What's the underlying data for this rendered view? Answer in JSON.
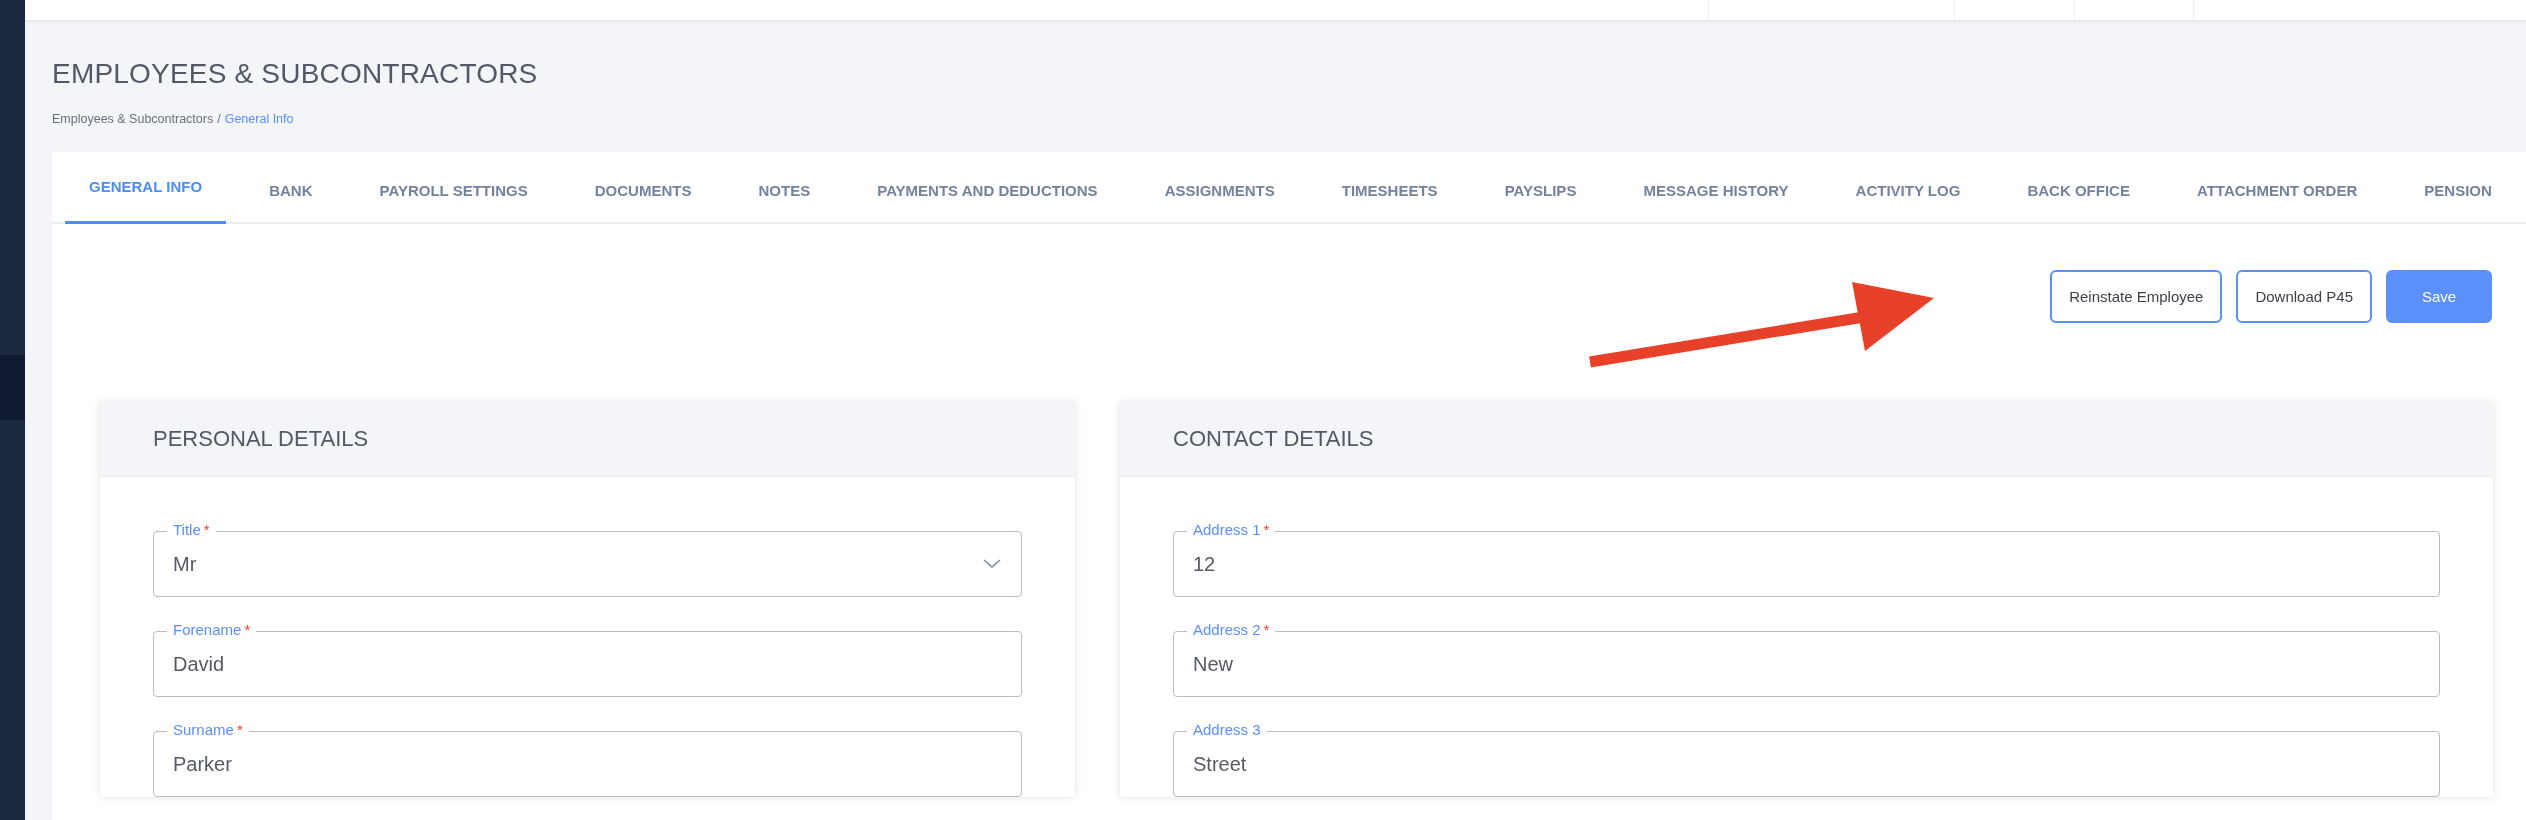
{
  "page_title": "EMPLOYEES & SUBCONTRACTORS",
  "breadcrumb": {
    "items": [
      {
        "label": "Employees & Subcontractors",
        "current": false
      },
      {
        "label": "General Info",
        "current": true
      }
    ],
    "separator": "/"
  },
  "tabs": [
    {
      "label": "GENERAL INFO",
      "selected": true
    },
    {
      "label": "BANK",
      "selected": false
    },
    {
      "label": "PAYROLL SETTINGS",
      "selected": false
    },
    {
      "label": "DOCUMENTS",
      "selected": false
    },
    {
      "label": "NOTES",
      "selected": false
    },
    {
      "label": "PAYMENTS AND DEDUCTIONS",
      "selected": false
    },
    {
      "label": "ASSIGNMENTS",
      "selected": false
    },
    {
      "label": "TIMESHEETS",
      "selected": false
    },
    {
      "label": "PAYSLIPS",
      "selected": false
    },
    {
      "label": "MESSAGE HISTORY",
      "selected": false
    },
    {
      "label": "ACTIVITY LOG",
      "selected": false
    },
    {
      "label": "BACK OFFICE",
      "selected": false
    },
    {
      "label": "ATTACHMENT ORDER",
      "selected": false
    },
    {
      "label": "PENSION",
      "selected": false
    }
  ],
  "actions": [
    {
      "label": "Reinstate Employee",
      "kind": "outline"
    },
    {
      "label": "Download P45",
      "kind": "outline"
    },
    {
      "label": "Save",
      "kind": "primary"
    }
  ],
  "sections": [
    {
      "title": "PERSONAL DETAILS",
      "fields": [
        {
          "label": "Title",
          "required_mark": "*",
          "value": "Mr",
          "kind": "select"
        },
        {
          "label": "Forename",
          "required_mark": "*",
          "value": "David",
          "kind": "text"
        },
        {
          "label": "Surname",
          "required_mark": "*",
          "value": "Parker",
          "kind": "text"
        }
      ]
    },
    {
      "title": "CONTACT DETAILS",
      "fields": [
        {
          "label": "Address 1",
          "required_mark": "*",
          "value": "12",
          "kind": "text"
        },
        {
          "label": "Address 2",
          "required_mark": "*",
          "value": "New",
          "kind": "text"
        },
        {
          "label": "Address 3",
          "value": "Street",
          "kind": "text"
        }
      ]
    }
  ]
}
